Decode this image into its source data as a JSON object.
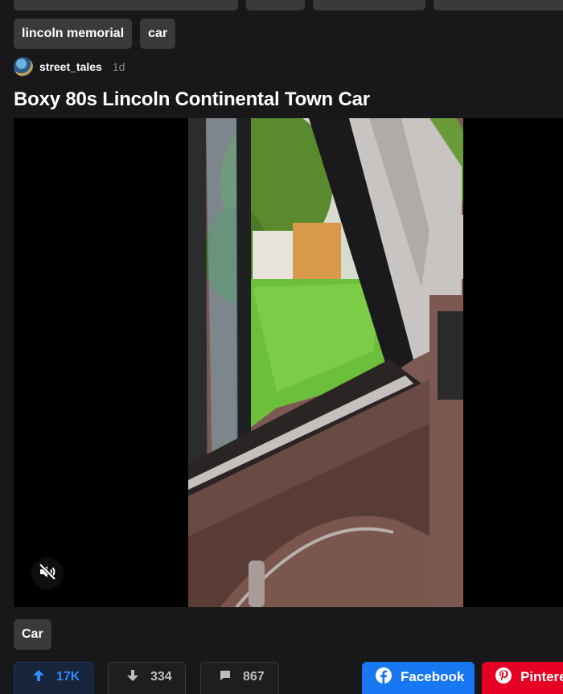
{
  "tags": [
    "lincoln memorial",
    "car"
  ],
  "author": {
    "username": "street_tales",
    "time": "1d"
  },
  "post": {
    "title": "Boxy 80s Lincoln Continental Town Car"
  },
  "video": {
    "muted": true
  },
  "category": "Car",
  "actions": {
    "upvotes": "17K",
    "downvotes": "334",
    "comments": "867"
  },
  "share": {
    "facebook": "Facebook",
    "pinterest": "Pinterest"
  },
  "colors": {
    "upvote_accent": "#2e8cff",
    "facebook": "#1877f2",
    "pinterest": "#e60023"
  },
  "icons": [
    "mute-icon",
    "arrow-up-icon",
    "arrow-down-icon",
    "comment-icon",
    "facebook-icon",
    "pinterest-icon"
  ]
}
